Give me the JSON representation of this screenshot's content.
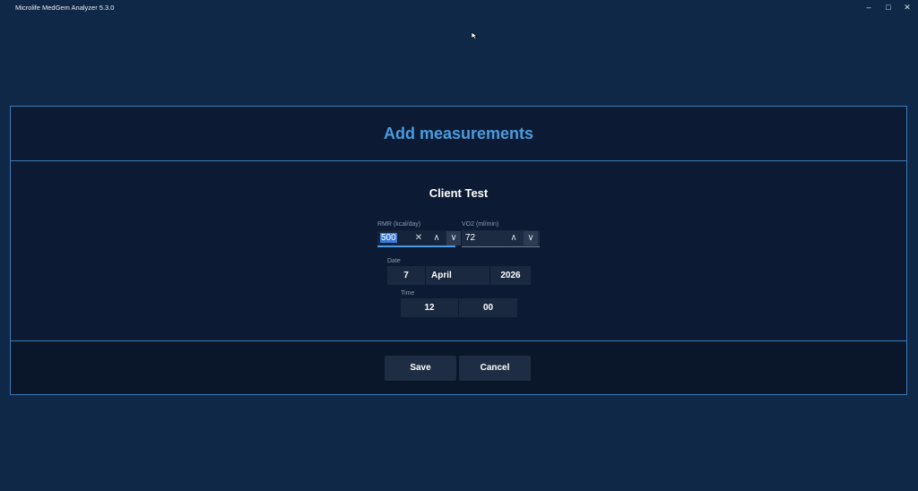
{
  "window": {
    "title": "Microlife MedGem Analyzer 5.3.0",
    "minimize_glyph": "–",
    "maximize_glyph": "□",
    "close_glyph": "✕"
  },
  "dialog": {
    "title": "Add measurements",
    "client_name": "Client Test",
    "rmr": {
      "label": "RMR (kcal/day)",
      "value": "500",
      "clear_glyph": "✕",
      "up_glyph": "∧",
      "down_glyph": "∨"
    },
    "vo2": {
      "label": "VO2 (ml/min)",
      "value": "72",
      "up_glyph": "∧",
      "down_glyph": "∨"
    },
    "date": {
      "label": "Date",
      "day": "7",
      "month": "April",
      "year": "2026"
    },
    "time": {
      "label": "Time",
      "hour": "12",
      "minute": "00"
    },
    "save_label": "Save",
    "cancel_label": "Cancel"
  }
}
